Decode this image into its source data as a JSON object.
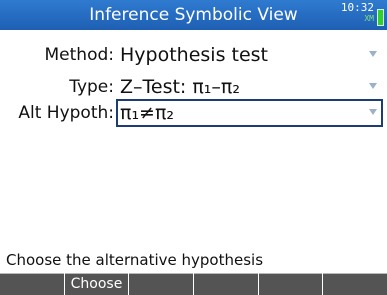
{
  "header": {
    "title": "Inference Symbolic View",
    "time": "10:32",
    "flags": "XM",
    "battery_level": 1.0
  },
  "fields": [
    {
      "label": "Method:",
      "value": "Hypothesis test",
      "selected": false
    },
    {
      "label": "Type:",
      "value": "Z–Test: π₁–π₂",
      "selected": false
    },
    {
      "label": "Alt Hypoth:",
      "value": "π₁≠π₂",
      "selected": true
    }
  ],
  "hint": "Choose the alternative hypothesis",
  "menu": [
    "",
    "Choose",
    "",
    "",
    "",
    ""
  ],
  "colors": {
    "titlebar": "#1e5fb3",
    "menukey": "#545454",
    "selection_border": "#1b3d73",
    "dropdown_arrow": "#9ab1c8",
    "battery": "#2fd12f"
  },
  "icons": [
    "dropdown-arrow-icon",
    "battery-icon"
  ]
}
